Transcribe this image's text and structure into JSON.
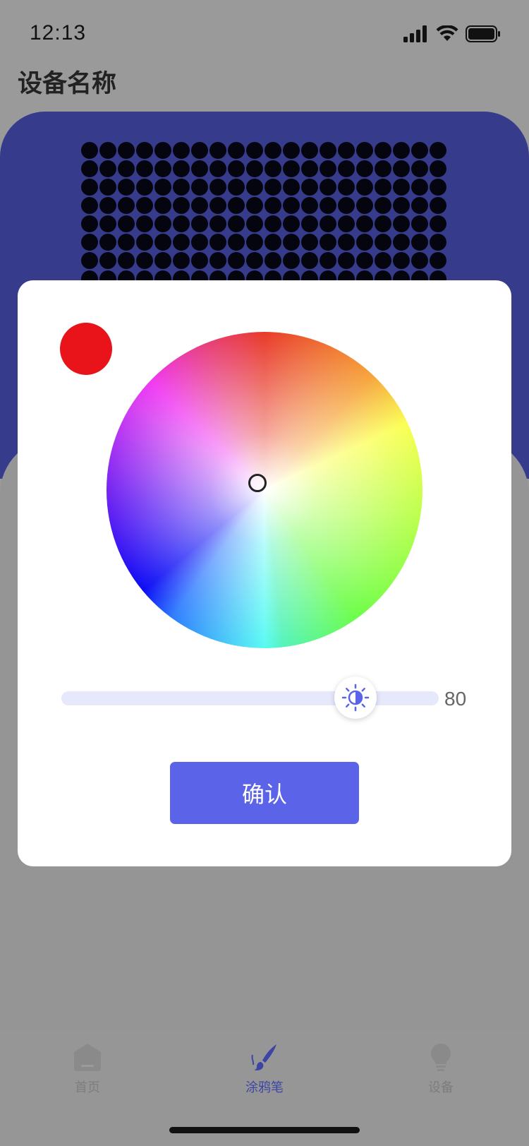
{
  "status_bar": {
    "time": "12:13",
    "icons": [
      "signal-icon",
      "wifi-icon",
      "battery-icon"
    ]
  },
  "page": {
    "title": "设备名称"
  },
  "color_picker": {
    "selected_color": "#e8141a",
    "brightness_value": "80",
    "brightness_fraction": 0.78,
    "confirm_label": "确认"
  },
  "tab_bar": {
    "items": [
      {
        "label": "首页",
        "icon": "home-icon",
        "active": false
      },
      {
        "label": "涂鸦笔",
        "icon": "brush-icon",
        "active": true
      },
      {
        "label": "设备",
        "icon": "bulb-icon",
        "active": false
      }
    ]
  },
  "colors": {
    "accent": "#5b64e8",
    "device_panel": "#363b8c",
    "overlay": "#9a9a9a"
  }
}
